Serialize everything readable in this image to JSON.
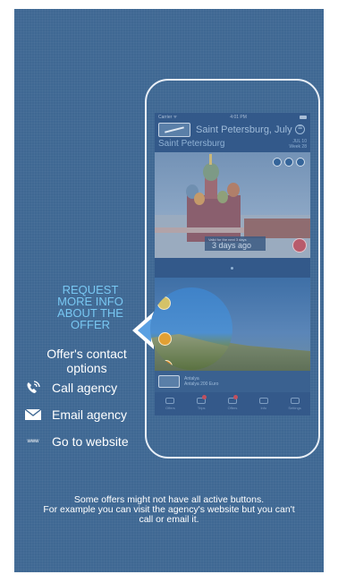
{
  "phone": {
    "status_left": "Carrier ᯤ",
    "status_time": "4:01 PM",
    "nav_title": "Saint Petersburg, July",
    "city": "Saint Petersburg",
    "date_line1": "JUL 10",
    "date_line2": "Week 28",
    "offer1_tag_small": "Valid for the next 3 days",
    "offer1_tag_big": "3 days ago",
    "offer2_line1": "Antalya",
    "offer2_line2": "Antalya 200 Euro",
    "tabs": [
      {
        "label": "Offers"
      },
      {
        "label": "Trips"
      },
      {
        "label": "Offers"
      },
      {
        "label": "Info"
      },
      {
        "label": "Settings"
      }
    ]
  },
  "request_info": [
    "REQUEST",
    "MORE INFO",
    "ABOUT THE",
    "OFFER"
  ],
  "contact_title": [
    "Offer's contact",
    "options"
  ],
  "actions": [
    {
      "icon": "phone-icon",
      "label": "Call agency"
    },
    {
      "icon": "mail-icon",
      "label": "Email agency"
    },
    {
      "icon": "www-icon",
      "icon_text": "www",
      "label": "Go to website"
    }
  ],
  "footnote": [
    "Some offers might not have all active buttons.",
    "For example you can visit the agency's website but you can't",
    "call or email it."
  ],
  "colors": {
    "panel": "#3f6893",
    "accent_blue": "#78c7f2",
    "text": "#ffffff"
  }
}
